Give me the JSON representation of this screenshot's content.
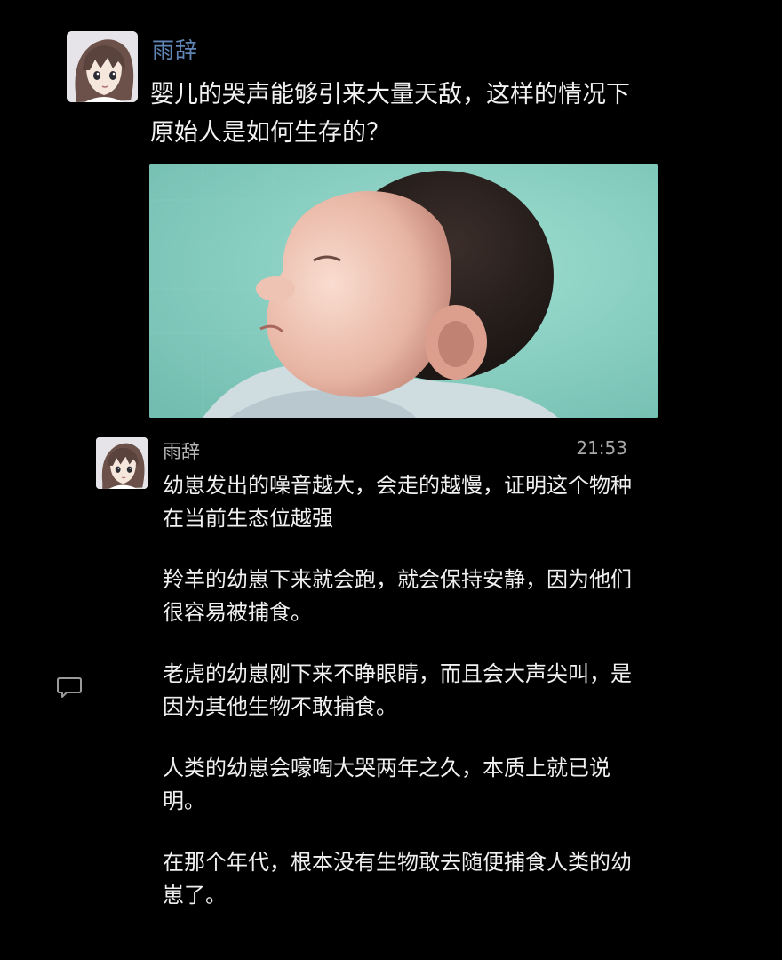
{
  "post": {
    "author": "雨辞",
    "title": "婴儿的哭声能够引来大量天敌，这样的情况下原始人是如何生存的？"
  },
  "comment": {
    "author": "雨辞",
    "time": "21:53",
    "paragraphs": [
      "幼崽发出的噪音越大，会走的越慢，证明这个物种在当前生态位越强",
      "羚羊的幼崽下来就会跑，就会保持安静，因为他们很容易被捕食。",
      "老虎的幼崽刚下来不睁眼睛，而且会大声尖叫，是因为其他生物不敢捕食。",
      "人类的幼崽会嚎啕大哭两年之久，本质上就已说明。",
      "在那个年代，根本没有生物敢去随便捕食人类的幼崽了。"
    ]
  },
  "icons": {
    "reply": "comment-bubble-icon"
  },
  "colors": {
    "background": "#000000",
    "author_name": "#5f86b5",
    "comment_text": "#f0f0f0",
    "timestamp": "#a9a9a9"
  }
}
